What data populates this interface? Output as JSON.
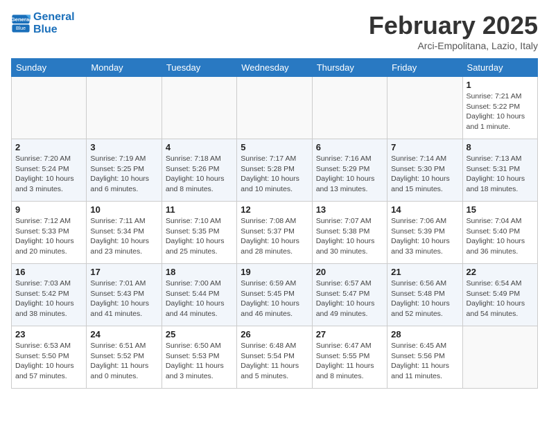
{
  "header": {
    "logo_line1": "General",
    "logo_line2": "Blue",
    "title": "February 2025",
    "subtitle": "Arci-Empolitana, Lazio, Italy"
  },
  "weekdays": [
    "Sunday",
    "Monday",
    "Tuesday",
    "Wednesday",
    "Thursday",
    "Friday",
    "Saturday"
  ],
  "weeks": [
    [
      {
        "day": "",
        "info": ""
      },
      {
        "day": "",
        "info": ""
      },
      {
        "day": "",
        "info": ""
      },
      {
        "day": "",
        "info": ""
      },
      {
        "day": "",
        "info": ""
      },
      {
        "day": "",
        "info": ""
      },
      {
        "day": "1",
        "info": "Sunrise: 7:21 AM\nSunset: 5:22 PM\nDaylight: 10 hours\nand 1 minute."
      }
    ],
    [
      {
        "day": "2",
        "info": "Sunrise: 7:20 AM\nSunset: 5:24 PM\nDaylight: 10 hours\nand 3 minutes."
      },
      {
        "day": "3",
        "info": "Sunrise: 7:19 AM\nSunset: 5:25 PM\nDaylight: 10 hours\nand 6 minutes."
      },
      {
        "day": "4",
        "info": "Sunrise: 7:18 AM\nSunset: 5:26 PM\nDaylight: 10 hours\nand 8 minutes."
      },
      {
        "day": "5",
        "info": "Sunrise: 7:17 AM\nSunset: 5:28 PM\nDaylight: 10 hours\nand 10 minutes."
      },
      {
        "day": "6",
        "info": "Sunrise: 7:16 AM\nSunset: 5:29 PM\nDaylight: 10 hours\nand 13 minutes."
      },
      {
        "day": "7",
        "info": "Sunrise: 7:14 AM\nSunset: 5:30 PM\nDaylight: 10 hours\nand 15 minutes."
      },
      {
        "day": "8",
        "info": "Sunrise: 7:13 AM\nSunset: 5:31 PM\nDaylight: 10 hours\nand 18 minutes."
      }
    ],
    [
      {
        "day": "9",
        "info": "Sunrise: 7:12 AM\nSunset: 5:33 PM\nDaylight: 10 hours\nand 20 minutes."
      },
      {
        "day": "10",
        "info": "Sunrise: 7:11 AM\nSunset: 5:34 PM\nDaylight: 10 hours\nand 23 minutes."
      },
      {
        "day": "11",
        "info": "Sunrise: 7:10 AM\nSunset: 5:35 PM\nDaylight: 10 hours\nand 25 minutes."
      },
      {
        "day": "12",
        "info": "Sunrise: 7:08 AM\nSunset: 5:37 PM\nDaylight: 10 hours\nand 28 minutes."
      },
      {
        "day": "13",
        "info": "Sunrise: 7:07 AM\nSunset: 5:38 PM\nDaylight: 10 hours\nand 30 minutes."
      },
      {
        "day": "14",
        "info": "Sunrise: 7:06 AM\nSunset: 5:39 PM\nDaylight: 10 hours\nand 33 minutes."
      },
      {
        "day": "15",
        "info": "Sunrise: 7:04 AM\nSunset: 5:40 PM\nDaylight: 10 hours\nand 36 minutes."
      }
    ],
    [
      {
        "day": "16",
        "info": "Sunrise: 7:03 AM\nSunset: 5:42 PM\nDaylight: 10 hours\nand 38 minutes."
      },
      {
        "day": "17",
        "info": "Sunrise: 7:01 AM\nSunset: 5:43 PM\nDaylight: 10 hours\nand 41 minutes."
      },
      {
        "day": "18",
        "info": "Sunrise: 7:00 AM\nSunset: 5:44 PM\nDaylight: 10 hours\nand 44 minutes."
      },
      {
        "day": "19",
        "info": "Sunrise: 6:59 AM\nSunset: 5:45 PM\nDaylight: 10 hours\nand 46 minutes."
      },
      {
        "day": "20",
        "info": "Sunrise: 6:57 AM\nSunset: 5:47 PM\nDaylight: 10 hours\nand 49 minutes."
      },
      {
        "day": "21",
        "info": "Sunrise: 6:56 AM\nSunset: 5:48 PM\nDaylight: 10 hours\nand 52 minutes."
      },
      {
        "day": "22",
        "info": "Sunrise: 6:54 AM\nSunset: 5:49 PM\nDaylight: 10 hours\nand 54 minutes."
      }
    ],
    [
      {
        "day": "23",
        "info": "Sunrise: 6:53 AM\nSunset: 5:50 PM\nDaylight: 10 hours\nand 57 minutes."
      },
      {
        "day": "24",
        "info": "Sunrise: 6:51 AM\nSunset: 5:52 PM\nDaylight: 11 hours\nand 0 minutes."
      },
      {
        "day": "25",
        "info": "Sunrise: 6:50 AM\nSunset: 5:53 PM\nDaylight: 11 hours\nand 3 minutes."
      },
      {
        "day": "26",
        "info": "Sunrise: 6:48 AM\nSunset: 5:54 PM\nDaylight: 11 hours\nand 5 minutes."
      },
      {
        "day": "27",
        "info": "Sunrise: 6:47 AM\nSunset: 5:55 PM\nDaylight: 11 hours\nand 8 minutes."
      },
      {
        "day": "28",
        "info": "Sunrise: 6:45 AM\nSunset: 5:56 PM\nDaylight: 11 hours\nand 11 minutes."
      },
      {
        "day": "",
        "info": ""
      }
    ]
  ]
}
